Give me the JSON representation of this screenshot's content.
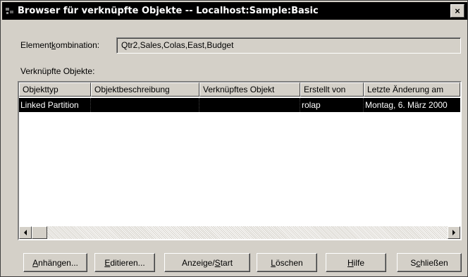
{
  "window": {
    "title": "Browser für verknüpfte Objekte -- Localhost:Sample:Basic",
    "close_label": "×"
  },
  "combination": {
    "label_pre": "Element",
    "label_mnemonic": "k",
    "label_post": "ombination:",
    "value": "Qtr2,Sales,Colas,East,Budget"
  },
  "linked_objects": {
    "label": "Verknüpfte Objekte:",
    "columns": [
      "Objekttyp",
      "Objektbeschreibung",
      "Verknüpftes Objekt",
      "Erstellt von",
      "Letzte Änderung am"
    ],
    "rows": [
      [
        "Linked Partition",
        "",
        "",
        "rolap",
        "Montag, 6. März 2000"
      ]
    ]
  },
  "buttons": [
    {
      "pre": "",
      "mnemonic": "A",
      "post": "nhängen..."
    },
    {
      "pre": "",
      "mnemonic": "E",
      "post": "ditieren..."
    },
    {
      "pre": "Anzeige/",
      "mnemonic": "S",
      "post": "tart"
    },
    {
      "pre": "",
      "mnemonic": "L",
      "post": "öschen"
    },
    {
      "pre": "",
      "mnemonic": "H",
      "post": "ilfe"
    },
    {
      "pre": "S",
      "mnemonic": "c",
      "post": "hließen"
    }
  ]
}
